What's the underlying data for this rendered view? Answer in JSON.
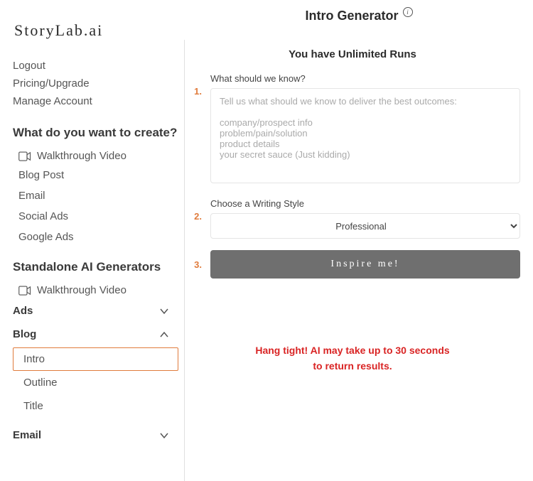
{
  "logo": "StoryLab.ai",
  "title": "Intro Generator",
  "runs_text": "You have Unlimited Runs",
  "sidebar": {
    "links": {
      "logout": "Logout",
      "pricing": "Pricing/Upgrade",
      "manage": "Manage Account"
    },
    "section1_title": "What do you want to create?",
    "walkthrough": "Walkthrough Video",
    "create_items": {
      "blog_post": "Blog Post",
      "email": "Email",
      "social_ads": "Social Ads",
      "google_ads": "Google Ads"
    },
    "section2_title": "Standalone AI Generators",
    "categories": {
      "ads": "Ads",
      "blog": "Blog",
      "email": "Email"
    },
    "blog_sub": {
      "intro": "Intro",
      "outline": "Outline",
      "title": "Title"
    }
  },
  "form": {
    "step1": "1.",
    "step2": "2.",
    "step3": "3.",
    "q1_label": "What should we know?",
    "q1_placeholder": "Tell us what should we know to deliver the best outcomes:\n\ncompany/prospect info\nproblem/pain/solution\nproduct details\nyour secret sauce (Just kidding)",
    "q2_label": "Choose a Writing Style",
    "q2_value": "Professional",
    "button": "Inspire me!"
  },
  "wait_line1": "Hang tight! AI may take up to 30 seconds",
  "wait_line2": "to return results."
}
